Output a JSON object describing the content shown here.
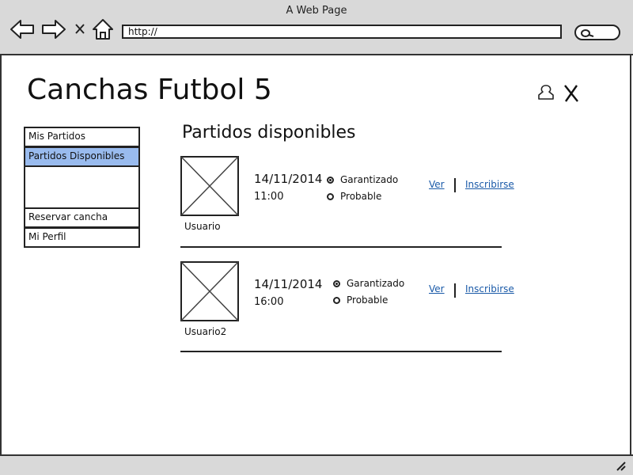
{
  "window": {
    "title": "A Web Page",
    "url": "http://"
  },
  "header": {
    "app_title": "Canchas Futbol 5"
  },
  "sidebar": {
    "items": [
      {
        "label": "Mis Partidos",
        "active": false
      },
      {
        "label": "Partidos Disponibles",
        "active": true
      },
      {
        "label": "Reservar cancha",
        "active": false
      },
      {
        "label": "Mi Perfil",
        "active": false
      }
    ]
  },
  "main": {
    "section_title": "Partidos disponibles",
    "matches": [
      {
        "user": "Usuario",
        "date": "14/11/2014",
        "time": "11:00",
        "options": [
          {
            "label": "Garantizado",
            "selected": true
          },
          {
            "label": "Probable",
            "selected": false
          }
        ],
        "links": {
          "view": "Ver",
          "join": "Inscribirse"
        }
      },
      {
        "user": "Usuario2",
        "date": "14/11/2014",
        "time": "16:00",
        "options": [
          {
            "label": "Garantizado",
            "selected": true
          },
          {
            "label": "Probable",
            "selected": false
          }
        ],
        "links": {
          "view": "Ver",
          "join": "Inscribirse"
        }
      }
    ]
  },
  "colors": {
    "chrome": "#d9d9d9",
    "active_item": "#99bbee",
    "link": "#1a5aa8"
  }
}
